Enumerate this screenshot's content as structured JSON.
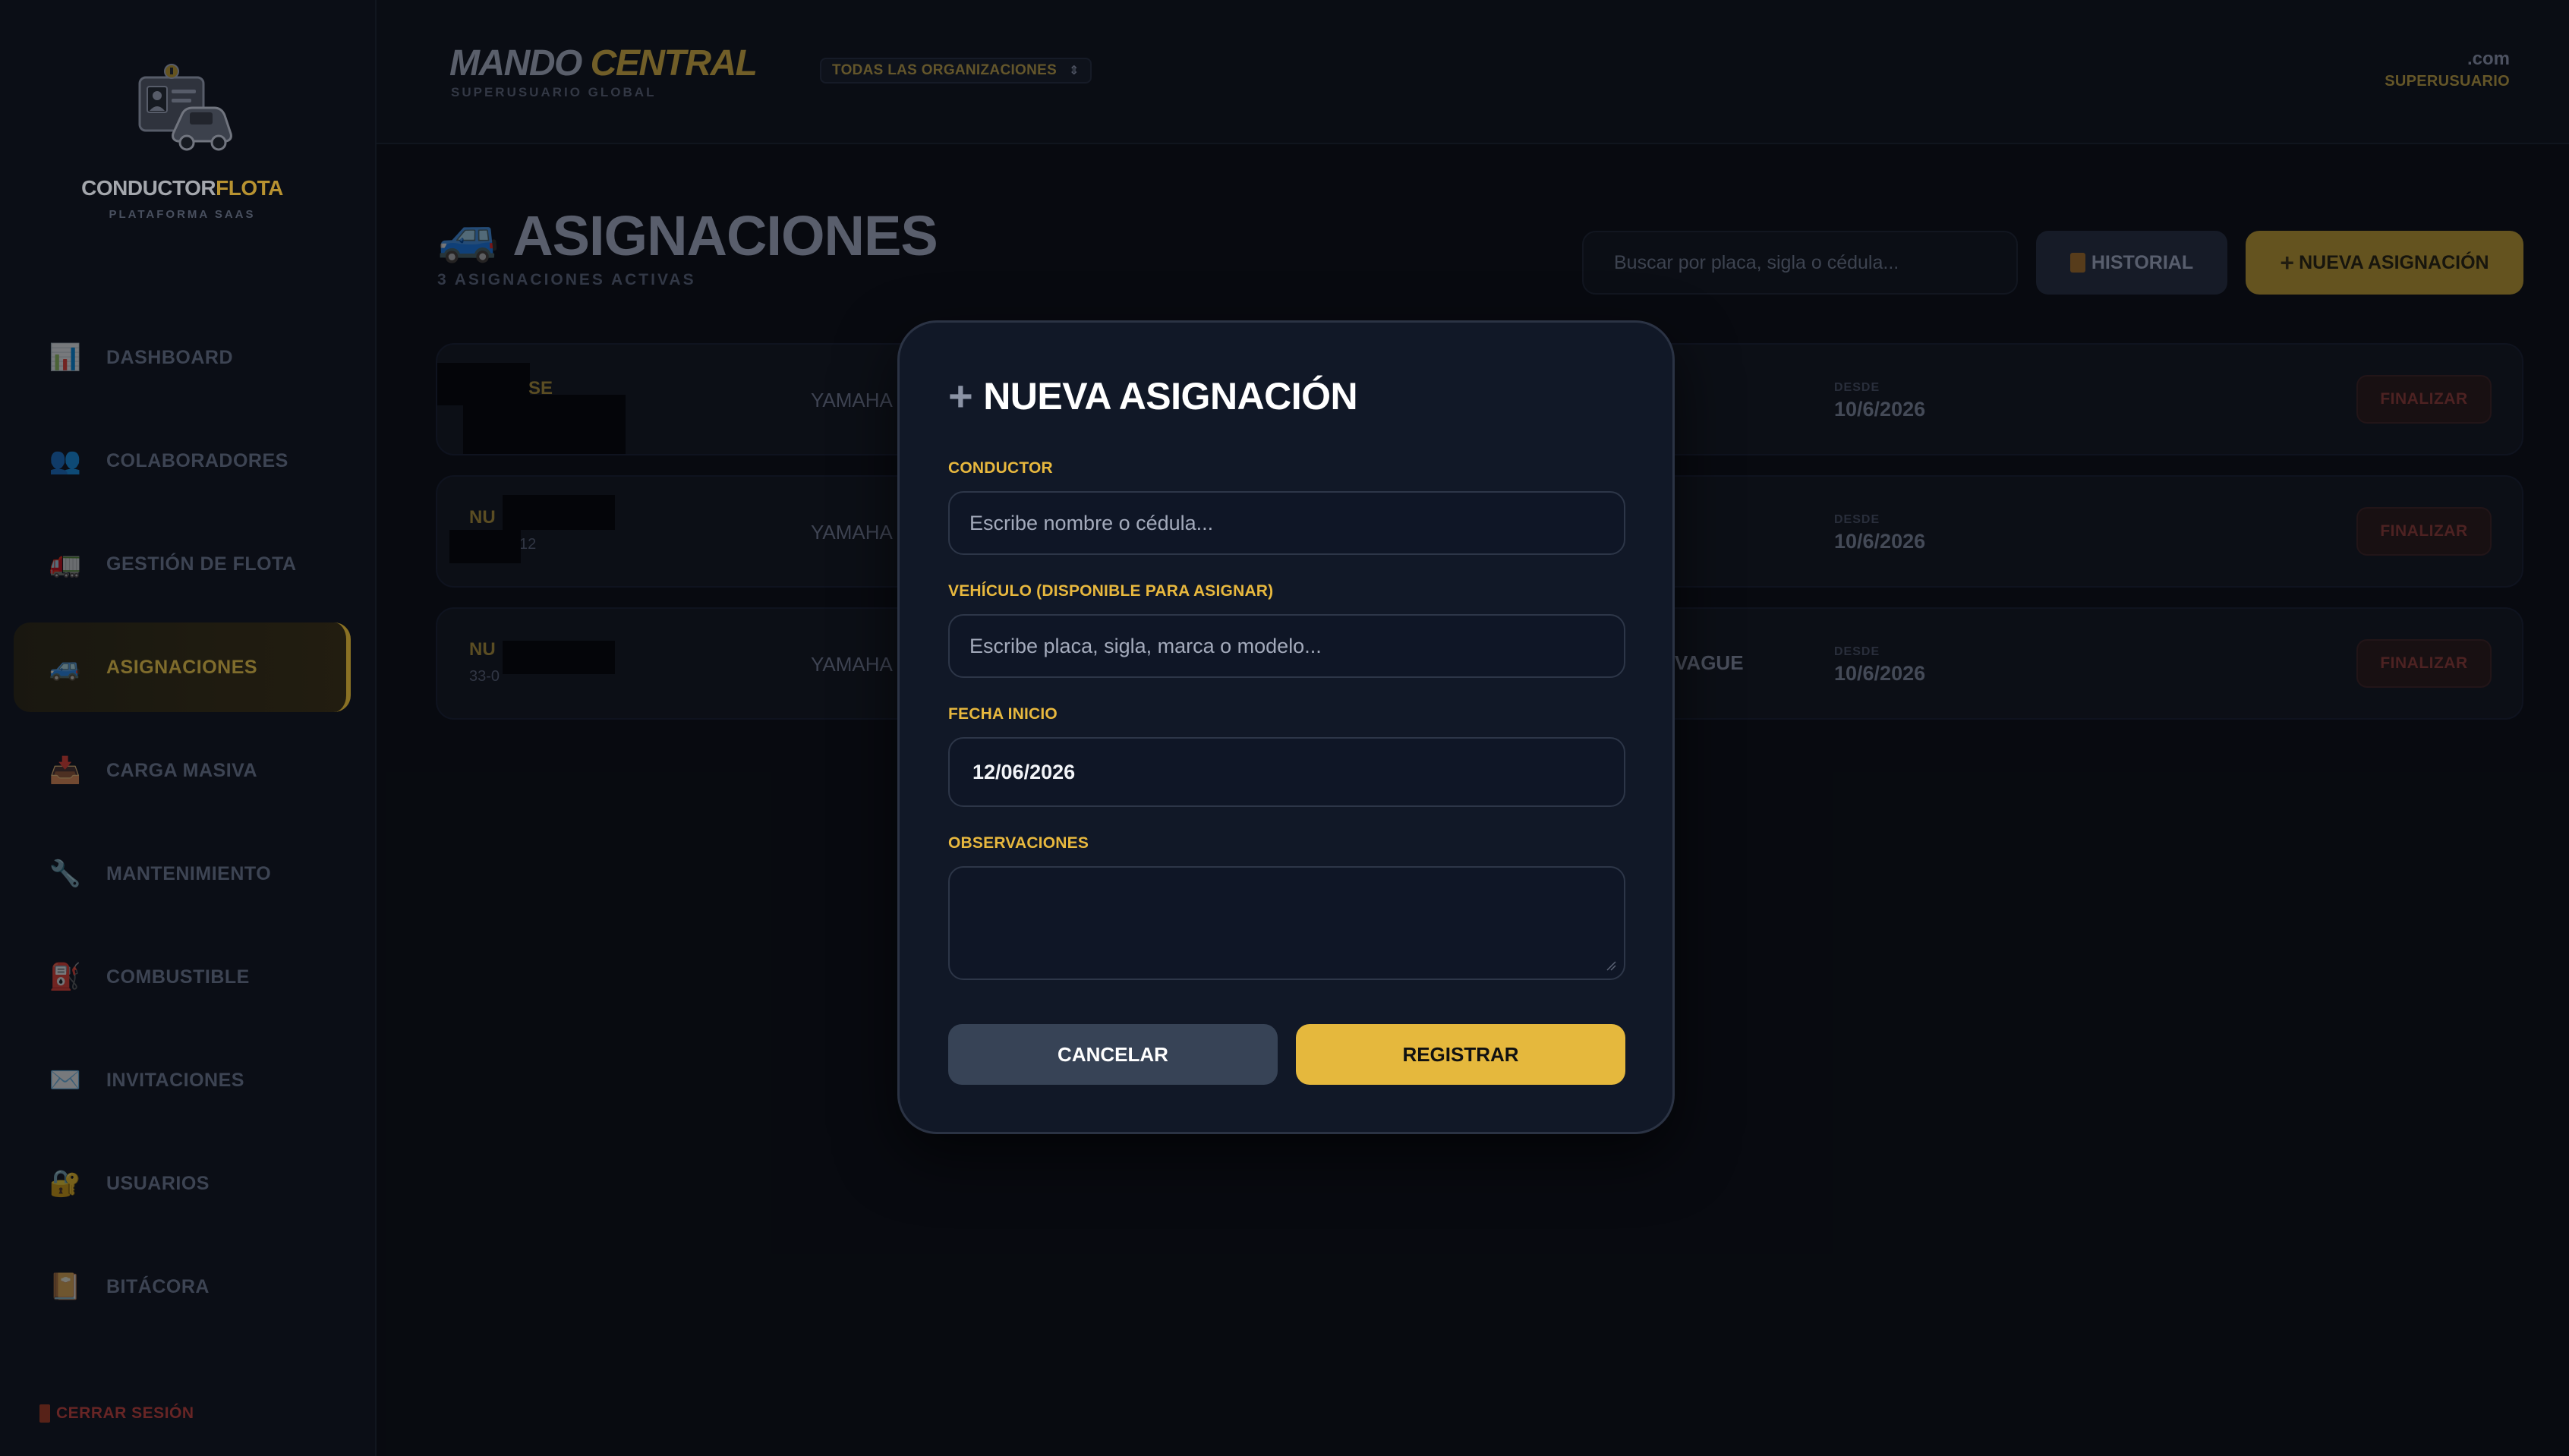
{
  "sidebar": {
    "brand": {
      "name_main": "CONDUCTOR",
      "name_accent": "FLOTA",
      "subtitle": "PLATAFORMA SAAS"
    },
    "items": [
      {
        "label": "DASHBOARD",
        "icon": "bar-chart-icon",
        "glyph": "📊"
      },
      {
        "label": "COLABORADORES",
        "icon": "users-icon",
        "glyph": "👥"
      },
      {
        "label": "GESTIÓN DE FLOTA",
        "icon": "truck-icon",
        "glyph": "🚛"
      },
      {
        "label": "ASIGNACIONES",
        "icon": "car-icon",
        "glyph": "🚙",
        "active": true
      },
      {
        "label": "CARGA MASIVA",
        "icon": "inbox-tray-icon",
        "glyph": "📥"
      },
      {
        "label": "MANTENIMIENTO",
        "icon": "wrench-icon",
        "glyph": "🔧"
      },
      {
        "label": "COMBUSTIBLE",
        "icon": "fuel-pump-icon",
        "glyph": "⛽"
      },
      {
        "label": "INVITACIONES",
        "icon": "envelope-icon",
        "glyph": "✉️"
      },
      {
        "label": "USUARIOS",
        "icon": "lock-key-icon",
        "glyph": "🔐"
      },
      {
        "label": "BITÁCORA",
        "icon": "book-icon",
        "glyph": "📔"
      }
    ],
    "logout_label": "CERRAR SESIÓN"
  },
  "topbar": {
    "title_main": "MANDO",
    "title_accent": "CENTRAL",
    "subtitle": "SUPERUSUARIO GLOBAL",
    "org_select": "TODAS LAS ORGANIZACIONES",
    "user_email": ".com",
    "user_role": "SUPERUSUARIO"
  },
  "main": {
    "title": "ASIGNACIONES",
    "title_emoji": "🚙",
    "subtitle": "3 ASIGNACIONES ACTIVAS",
    "search_placeholder": "Buscar por placa, sigla o cédula...",
    "history_label": "HISTORIAL",
    "new_label": "NUEVA ASIGNACIÓN",
    "rows": [
      {
        "driver": "SE",
        "driver_id": "",
        "vehicle": "YAMAHA X",
        "extra": "",
        "since_label": "DESDE",
        "since": "10/6/2026",
        "action": "FINALIZAR"
      },
      {
        "driver": "NU",
        "driver_id": "12",
        "vehicle": "YAMAHA X",
        "extra": "",
        "since_label": "DESDE",
        "since": "10/6/2026",
        "action": "FINALIZAR"
      },
      {
        "driver": "NU",
        "driver_id": "33-0",
        "vehicle": "YAMAHA X",
        "extra": "VAGUE",
        "since_label": "DESDE",
        "since": "10/6/2026",
        "action": "FINALIZAR"
      }
    ]
  },
  "modal": {
    "title": "NUEVA ASIGNACIÓN",
    "conductor_label": "CONDUCTOR",
    "conductor_placeholder": "Escribe nombre o cédula...",
    "vehicle_label": "VEHÍCULO (DISPONIBLE PARA ASIGNAR)",
    "vehicle_placeholder": "Escribe placa, sigla, marca o modelo...",
    "date_label": "FECHA INICIO",
    "date_value": "12/06/2026",
    "notes_label": "OBSERVACIONES",
    "cancel_label": "CANCELAR",
    "register_label": "REGISTRAR"
  },
  "colors": {
    "accent": "#e5b83d",
    "background": "#0a0d14",
    "modal_bg": "#111827",
    "danger": "#5e2a2a"
  }
}
